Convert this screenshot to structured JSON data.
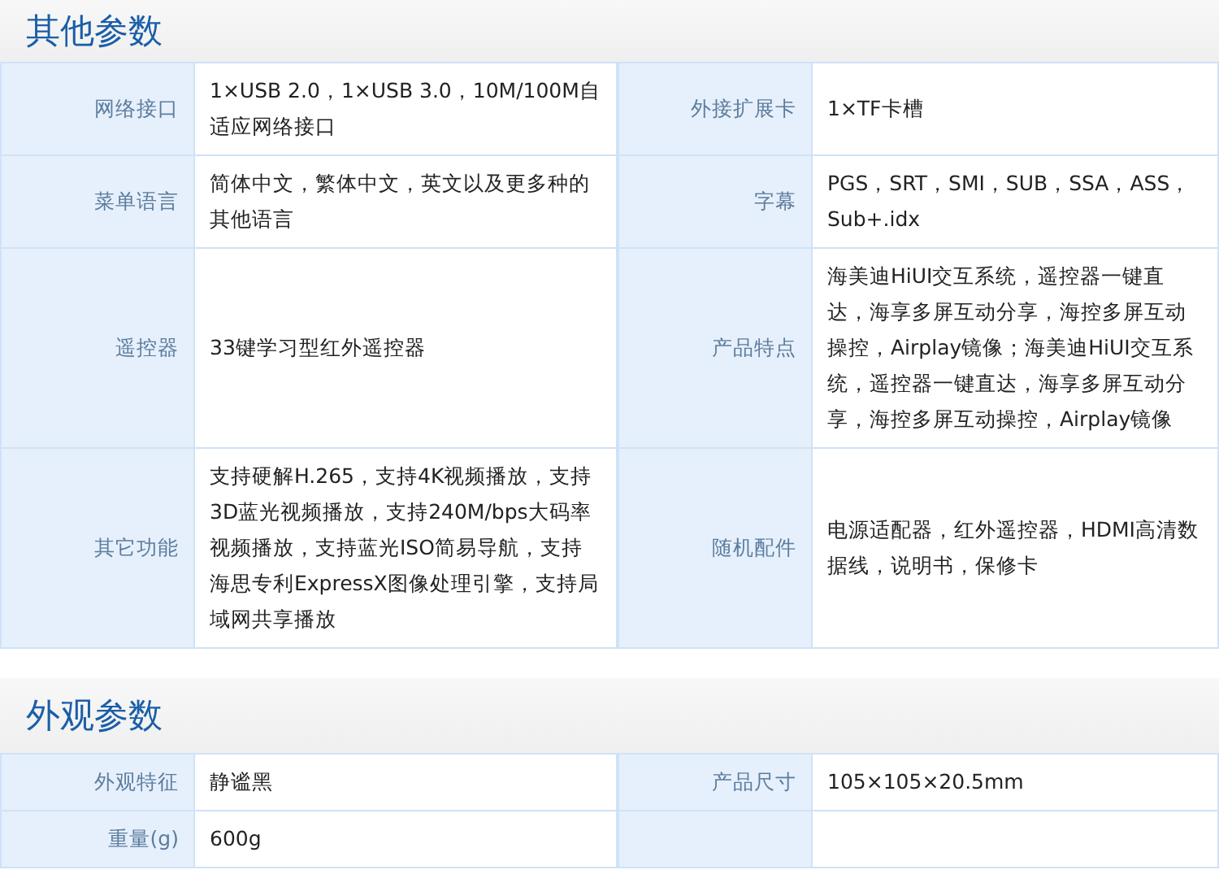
{
  "sections": [
    {
      "title": "其他参数",
      "rows": [
        [
          {
            "label": "网络接口",
            "value": "1×USB 2.0，1×USB 3.0，10M/100M自适应网络接口"
          },
          {
            "label": "外接扩展卡",
            "value": "1×TF卡槽"
          }
        ],
        [
          {
            "label": "菜单语言",
            "value": "简体中文，繁体中文，英文以及更多种的其他语言"
          },
          {
            "label": "字幕",
            "value": "PGS，SRT，SMI，SUB，SSA，ASS，Sub+.idx"
          }
        ],
        [
          {
            "label": "遥控器",
            "value": "33键学习型红外遥控器"
          },
          {
            "label": "产品特点",
            "value": "海美迪HiUI交互系统，遥控器一键直达，海享多屏互动分享，海控多屏互动操控，Airplay镜像；海美迪HiUI交互系统，遥控器一键直达，海享多屏互动分享，海控多屏互动操控，Airplay镜像"
          }
        ],
        [
          {
            "label": "其它功能",
            "value": "支持硬解H.265，支持4K视频播放，支持3D蓝光视频播放，支持240M/bps大码率视频播放，支持蓝光ISO简易导航，支持海思专利ExpressX图像处理引擎，支持局域网共享播放"
          },
          {
            "label": "随机配件",
            "value": "电源适配器，红外遥控器，HDMI高清数据线，说明书，保修卡"
          }
        ]
      ]
    },
    {
      "title": "外观参数",
      "rows": [
        [
          {
            "label": "外观特征",
            "value": "静谧黑"
          },
          {
            "label": "产品尺寸",
            "value": "105×105×20.5mm"
          }
        ],
        [
          {
            "label": "重量(g)",
            "value": "600g"
          }
        ]
      ]
    }
  ]
}
